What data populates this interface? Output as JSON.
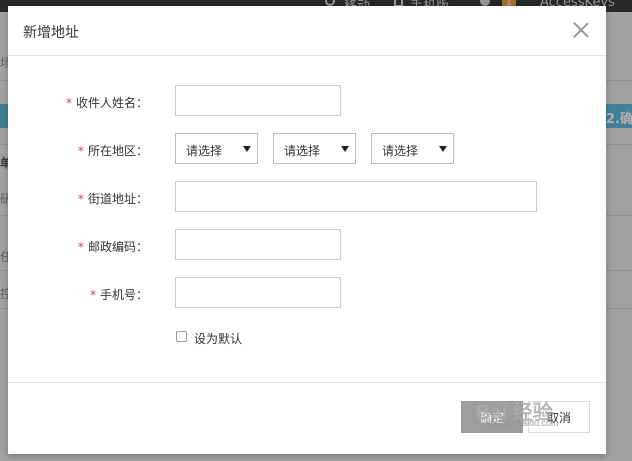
{
  "background": {
    "top_nav": [
      {
        "label": "移动"
      },
      {
        "label": "手机版"
      },
      {
        "label": "1"
      },
      {
        "label": "AccessKeys"
      }
    ],
    "blue_bar_text": "2.确",
    "side_texts": [
      "场",
      "单",
      "研",
      "任",
      "控"
    ]
  },
  "modal": {
    "title": "新增地址",
    "fields": {
      "name_label": "收件人姓名：",
      "region_label": "所在地区：",
      "street_label": "街道地址：",
      "postal_label": "邮政编码：",
      "phone_label": "手机号：",
      "required_mark": "*"
    },
    "region_selects": [
      {
        "selected": "请选择"
      },
      {
        "selected": "请选择"
      },
      {
        "selected": "请选择"
      }
    ],
    "default_checkbox_label": "设为默认",
    "confirm_label": "确定",
    "cancel_label": "取消"
  },
  "watermark": {
    "text": "Bai 经验",
    "sub": "jingyan.baidu.com"
  },
  "colors": {
    "required": "#ee3333",
    "bar_blue": "#5fb8d8",
    "confirm_bg": "#9e9e9e"
  }
}
